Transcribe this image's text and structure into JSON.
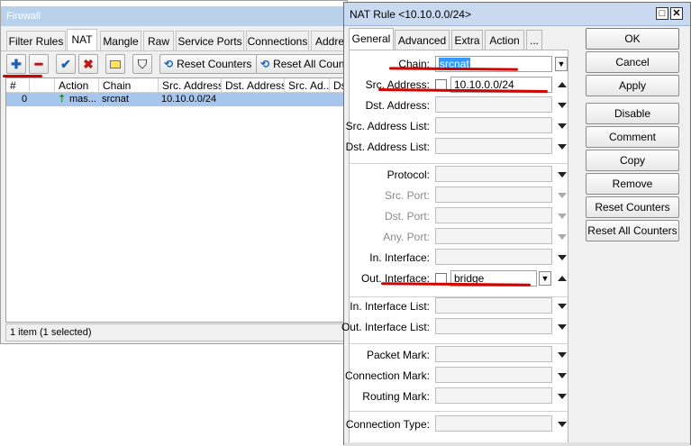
{
  "firewall": {
    "title": "Firewall",
    "tabs": [
      "Filter Rules",
      "NAT",
      "Mangle",
      "Raw",
      "Service Ports",
      "Connections",
      "Addre"
    ],
    "toolbar": {
      "reset_counters": "Reset Counters",
      "reset_all_counters": "Reset All Counte"
    },
    "columns": [
      "#",
      "Action",
      "Chain",
      "Src. Address",
      "Dst. Address",
      "Src. Ad...",
      "Dst"
    ],
    "rows": [
      {
        "num": "0",
        "action": "mas...",
        "chain": "srcnat",
        "src_address": "10.10.0.0/24"
      }
    ],
    "status": "1 item (1 selected)"
  },
  "dialog": {
    "title": "NAT Rule <10.10.0.0/24>",
    "tabs": [
      "General",
      "Advanced",
      "Extra",
      "Action",
      "..."
    ],
    "fields": {
      "chain": {
        "label": "Chain:",
        "value": "srcnat"
      },
      "src_address": {
        "label": "Src. Address:",
        "value": "10.10.0.0/24"
      },
      "dst_address": {
        "label": "Dst. Address:"
      },
      "src_address_list": {
        "label": "Src. Address List:"
      },
      "dst_address_list": {
        "label": "Dst. Address List:"
      },
      "protocol": {
        "label": "Protocol:"
      },
      "src_port": {
        "label": "Src. Port:"
      },
      "dst_port": {
        "label": "Dst. Port:"
      },
      "any_port": {
        "label": "Any. Port:"
      },
      "in_interface": {
        "label": "In. Interface:"
      },
      "out_interface": {
        "label": "Out. Interface:",
        "value": "bridge"
      },
      "in_interface_list": {
        "label": "In. Interface List:"
      },
      "out_interface_list": {
        "label": "Out. Interface List:"
      },
      "packet_mark": {
        "label": "Packet Mark:"
      },
      "connection_mark": {
        "label": "Connection Mark:"
      },
      "routing_mark": {
        "label": "Routing Mark:"
      },
      "connection_type": {
        "label": "Connection Type:"
      }
    },
    "buttons": [
      "OK",
      "Cancel",
      "Apply",
      "Disable",
      "Comment",
      "Copy",
      "Remove",
      "Reset Counters",
      "Reset All Counters"
    ]
  },
  "colors": {
    "annotation_red": "#d40000",
    "selection": "#a7c6ee"
  }
}
